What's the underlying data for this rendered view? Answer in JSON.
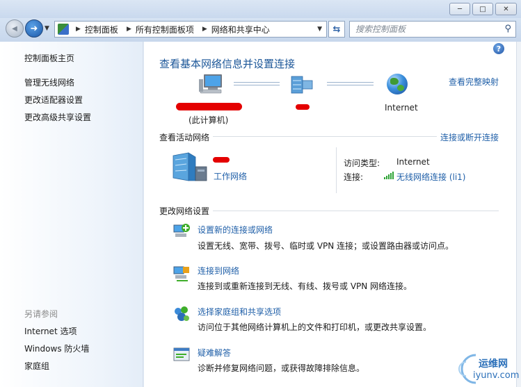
{
  "window": {
    "min_glyph": "─",
    "max_glyph": "□",
    "close_glyph": "✕"
  },
  "navbar": {
    "back_glyph": "◀",
    "forward_glyph": "➜",
    "breadcrumbs": [
      "控制面板",
      "所有控制面板项",
      "网络和共享中心"
    ],
    "search_placeholder": "搜索控制面板"
  },
  "sidebar": {
    "items": [
      {
        "label": "控制面板主页"
      },
      {
        "label": "管理无线网络"
      },
      {
        "label": "更改适配器设置"
      },
      {
        "label": "更改高级共享设置"
      }
    ],
    "see_also_title": "另请参阅",
    "see_also": [
      {
        "label": "Internet 选项"
      },
      {
        "label": "Windows 防火墙"
      },
      {
        "label": "家庭组"
      }
    ]
  },
  "main": {
    "title": "查看基本网络信息并设置连接",
    "view_full_map": "查看完整映射",
    "map": {
      "this_computer": "(此计算机)",
      "internet": "Internet"
    },
    "active_networks_title": "查看活动网络",
    "connect_disconnect": "连接或断开连接",
    "network": {
      "type_link": "工作网络",
      "access_type_label": "访问类型:",
      "access_type_value": "Internet",
      "connection_label": "连接:",
      "connection_value": "无线网络连接 (li1)"
    },
    "change_settings_title": "更改网络设置",
    "tasks": [
      {
        "title": "设置新的连接或网络",
        "desc": "设置无线、宽带、拨号、临时或 VPN 连接；或设置路由器或访问点。"
      },
      {
        "title": "连接到网络",
        "desc": "连接到或重新连接到无线、有线、拨号或 VPN 网络连接。"
      },
      {
        "title": "选择家庭组和共享选项",
        "desc": "访问位于其他网络计算机上的文件和打印机，或更改共享设置。"
      },
      {
        "title": "疑难解答",
        "desc": "诊断并修复网络问题，或获得故障排除信息。"
      }
    ]
  },
  "watermark": {
    "line1": "运维网",
    "line2": "iyunv.com"
  },
  "colors": {
    "link": "#1f5fa8",
    "title": "#1b5698",
    "redaction": "#e40000"
  }
}
